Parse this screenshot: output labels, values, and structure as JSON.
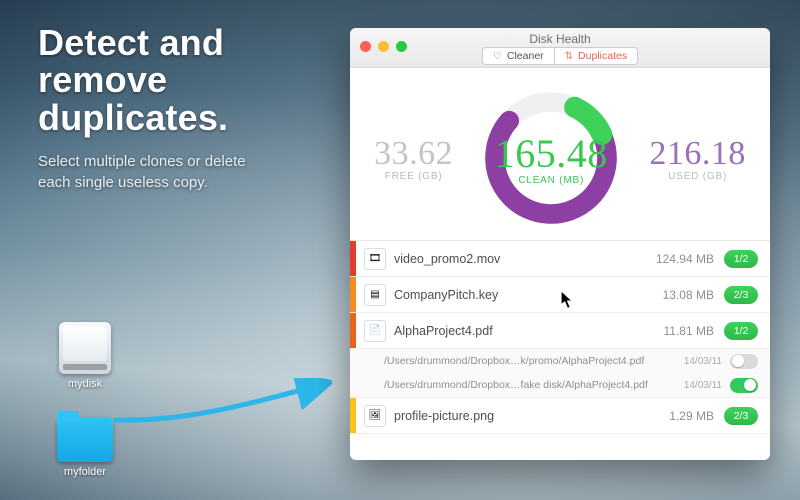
{
  "marketing": {
    "headline": "Detect and remove duplicates.",
    "subhead": "Select multiple clones or delete each single useless copy."
  },
  "desktop": {
    "disk_label": "mydisk",
    "folder_label": "myfolder"
  },
  "app": {
    "title": "Disk Health",
    "tabs": {
      "cleaner": "Cleaner",
      "duplicates": "Duplicates"
    },
    "stats": {
      "free": {
        "value": "33.62",
        "unit": "FREE (GB)"
      },
      "clean": {
        "value": "165.48",
        "unit": "CLEAN (MB)"
      },
      "used": {
        "value": "216.18",
        "unit": "USED (GB)"
      }
    },
    "files": [
      {
        "name": "video_promo2.mov",
        "size": "124.94 MB",
        "ratio": "1/2"
      },
      {
        "name": "CompanyPitch.key",
        "size": "13.08 MB",
        "ratio": "2/3"
      },
      {
        "name": "AlphaProject4.pdf",
        "size": "11.81 MB",
        "ratio": "1/2",
        "paths": [
          {
            "p": "/Users/drummond/Dropbox…k/promo/AlphaProject4.pdf",
            "date": "14/03/11",
            "on": false
          },
          {
            "p": "/Users/drummond/Dropbox…fake disk/AlphaProject4.pdf",
            "date": "14/03/11",
            "on": true
          }
        ]
      },
      {
        "name": "profile-picture.png",
        "size": "1.29 MB",
        "ratio": "2/3"
      }
    ]
  }
}
